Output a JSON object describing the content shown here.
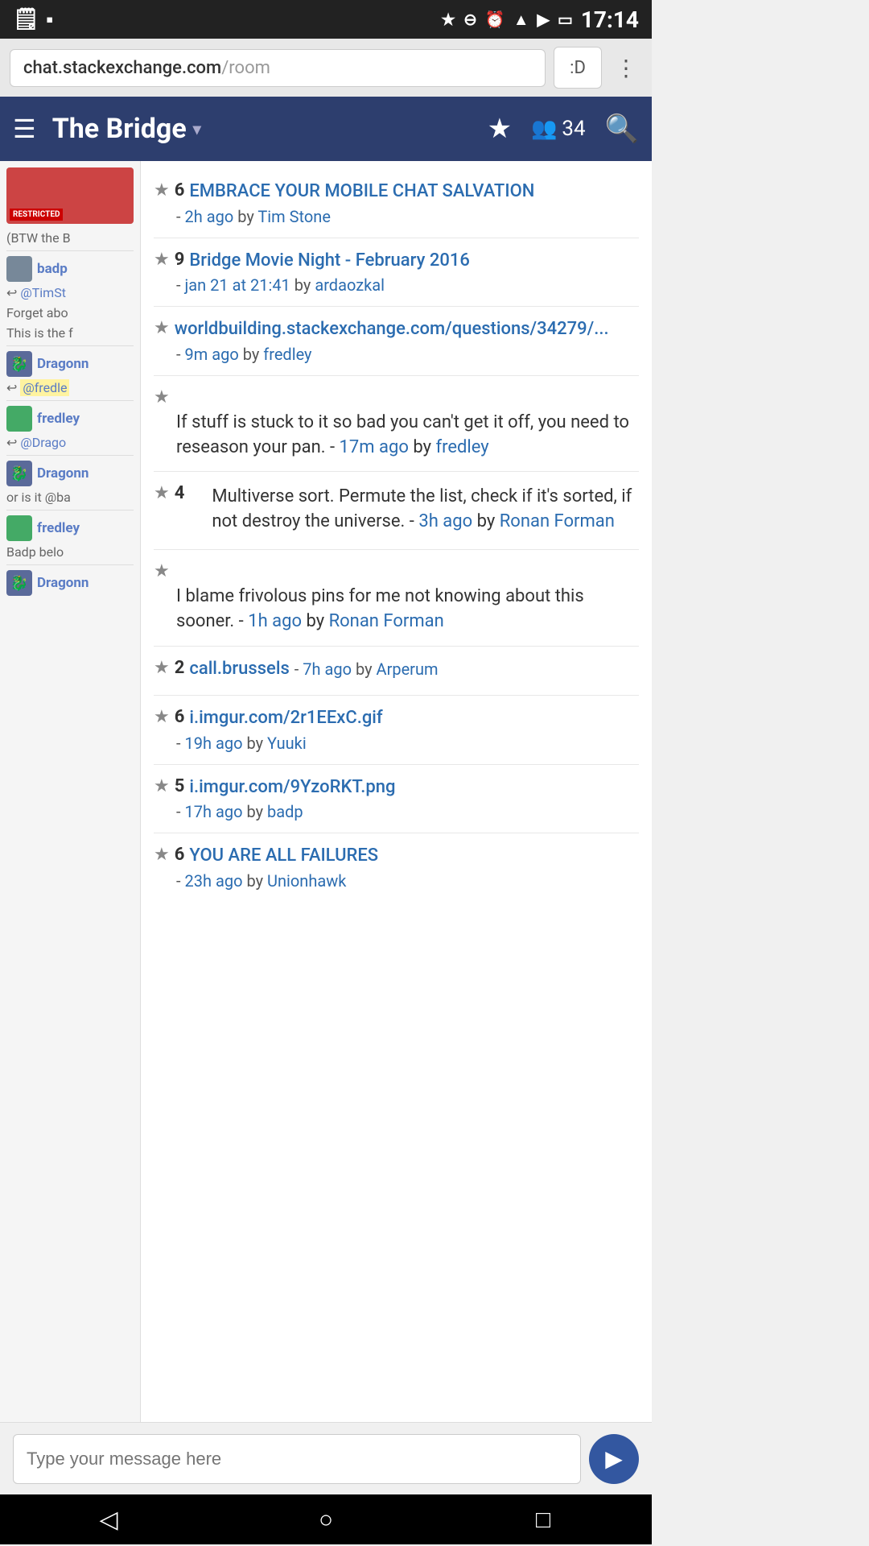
{
  "statusBar": {
    "time": "17:14",
    "icons": [
      "document",
      "square",
      "bluetooth",
      "minus-circle",
      "clock",
      "wifi",
      "signal",
      "battery"
    ]
  },
  "urlBar": {
    "domain": "chat.stackexchange.com",
    "path": "/room",
    "iconLabel": ":D",
    "moreLabel": "⋮"
  },
  "topNav": {
    "hamburger": "☰",
    "title": "The Bridge",
    "dropdownArrow": "▾",
    "starLabel": "★",
    "userCount": "34",
    "searchLabel": "🔍"
  },
  "sidebar": {
    "bannerAlt": "restricted chat banner",
    "restrictedLabel": "RESTRICTED",
    "messages": [
      {
        "text": "(BTW the B",
        "type": "text"
      },
      {
        "username": "badp",
        "type": "user"
      },
      {
        "reply": "@TimSt",
        "type": "reply"
      },
      {
        "text": "Forget abo",
        "type": "text"
      },
      {
        "text": "This is the f",
        "type": "text"
      },
      {
        "username": "Dragonn",
        "type": "user",
        "avatarType": "dragon"
      },
      {
        "reply": "@fredle",
        "type": "reply",
        "highlight": true
      },
      {
        "username": "fredley",
        "type": "user",
        "avatarType": "blue"
      },
      {
        "reply": "@Drago",
        "type": "reply"
      },
      {
        "username": "Dragonn",
        "type": "user",
        "avatarType": "dragon"
      },
      {
        "text": "or is it @ba",
        "type": "text"
      },
      {
        "username": "fredley",
        "type": "user",
        "avatarType": "blue"
      },
      {
        "text": "Badp belo",
        "type": "text"
      },
      {
        "username": "Dragonn",
        "type": "user",
        "avatarType": "dragon"
      }
    ]
  },
  "pinnedMessages": [
    {
      "id": 1,
      "starCount": "6",
      "title": "EMBRACE YOUR MOBILE CHAT SALVATION",
      "timeAgo": "2h ago",
      "author": "Tim Stone",
      "hasCount": true,
      "isLink": false
    },
    {
      "id": 2,
      "starCount": "9",
      "title": "Bridge Movie Night - February 2016",
      "timeAgo": "jan 21 at 21:41",
      "author": "ardaozkal",
      "hasCount": true,
      "isLink": false,
      "isTitleLink": true
    },
    {
      "id": 3,
      "starCount": null,
      "title": "worldbuilding.stackexchange.com/questions/34279/...",
      "timeAgo": "9m ago",
      "author": "fredley",
      "hasCount": false,
      "isLink": true
    },
    {
      "id": 4,
      "starCount": null,
      "title": "If stuff is stuck to it so bad you can't get it off, you need to reseason your pan.",
      "timeAgo": "17m ago",
      "author": "fredley",
      "hasCount": false,
      "isLink": false
    },
    {
      "id": 5,
      "starCount": "4",
      "title": "Multiverse sort. Permute the list, check if it's sorted, if not destroy the universe.",
      "timeAgo": "3h ago",
      "author": "Ronan Forman",
      "hasCount": true,
      "isLink": false
    },
    {
      "id": 6,
      "starCount": null,
      "title": "I blame frivolous pins for me not knowing about this sooner.",
      "timeAgo": "1h ago",
      "author": "Ronan Forman",
      "hasCount": false,
      "isLink": false
    },
    {
      "id": 7,
      "starCount": "2",
      "title": "call.brussels",
      "timeAgo": "7h ago",
      "author": "Arperum",
      "hasCount": true,
      "isLink": true
    },
    {
      "id": 8,
      "starCount": "6",
      "title": "i.imgur.com/2r1EExC.gif",
      "timeAgo": "19h ago",
      "author": "Yuuki",
      "hasCount": true,
      "isLink": true
    },
    {
      "id": 9,
      "starCount": "5",
      "title": "i.imgur.com/9YzoRKT.png",
      "timeAgo": "17h ago",
      "author": "badp",
      "hasCount": true,
      "isLink": true
    },
    {
      "id": 10,
      "starCount": "6",
      "title": "YOU ARE ALL FAILURES",
      "timeAgo": "23h ago",
      "author": "Unionhawk",
      "hasCount": true,
      "isLink": false
    }
  ],
  "inputArea": {
    "placeholder": "Type your message here",
    "sendLabel": "▶"
  },
  "bottomNav": {
    "back": "◁",
    "home": "○",
    "recents": "□"
  }
}
